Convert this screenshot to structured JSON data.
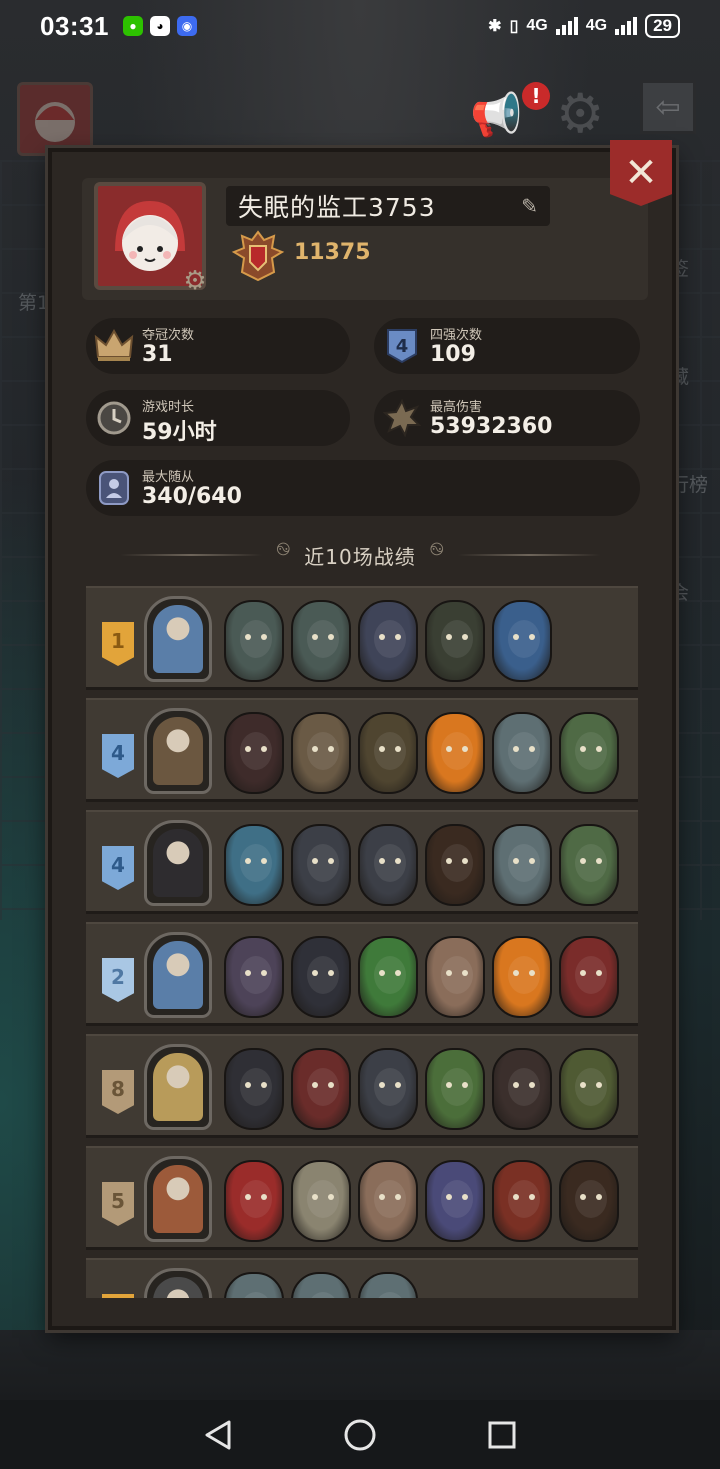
{
  "status_bar": {
    "time": "03:31",
    "network_1": "4G",
    "network_2": "4G",
    "battery": "29"
  },
  "background": {
    "side_labels": [
      "第1",
      "签",
      "藏",
      "行榜",
      "会"
    ]
  },
  "profile": {
    "name": "失眠的监工3753",
    "rating": "11375"
  },
  "stats": {
    "championships": {
      "label": "夺冠次数",
      "value": "31"
    },
    "top4": {
      "label": "四强次数",
      "value": "109"
    },
    "playtime": {
      "label": "游戏时长",
      "value": "59小时"
    },
    "max_damage": {
      "label": "最高伤害",
      "value": "53932360"
    },
    "max_minions": {
      "label": "最大随从",
      "value": "340/640"
    }
  },
  "recent": {
    "title": "近10场战绩"
  },
  "matches": [
    {
      "place": "1",
      "style": "gold",
      "hero_color": "#5a7ea8",
      "minions": [
        "#4a5a55",
        "#4a5a55",
        "#3f4458",
        "#3a3f33",
        "#3a5f8c"
      ]
    },
    {
      "place": "4",
      "style": "blue",
      "hero_color": "#6b5740",
      "minions": [
        "#3e2b2a",
        "#6a5a45",
        "#4f4530",
        "#d9771f",
        "#5e6f73",
        "#4f6a45"
      ]
    },
    {
      "place": "4",
      "style": "blue",
      "hero_color": "#2e2c2f",
      "minions": [
        "#3f6f86",
        "#3c3f47",
        "#3c3f47",
        "#3a2a20",
        "#5e6f73",
        "#4f6a45"
      ]
    },
    {
      "place": "2",
      "style": "lightblue",
      "hero_color": "#5a7ea8",
      "minions": [
        "#4d4358",
        "#2f3038",
        "#3f7a3a",
        "#8a6d5a",
        "#d9771f",
        "#7a2c2a"
      ]
    },
    {
      "place": "8",
      "style": "tan",
      "hero_color": "#b89b5a",
      "minions": [
        "#2f2f35",
        "#6a2c2a",
        "#3c3f47",
        "#4b6e3a",
        "#3b2f2c",
        "#4f5a33"
      ]
    },
    {
      "place": "5",
      "style": "tan",
      "hero_color": "#9c5a3a",
      "minions": [
        "#9a2c2a",
        "#8a8470",
        "#8a6d5a",
        "#4a4a78",
        "#7a3024",
        "#3a2a20"
      ]
    },
    {
      "place": "",
      "style": "gold",
      "hero_color": "#4a4a4a",
      "minions": [
        "#5e6f73",
        "#5e6f73",
        "#5e6f73"
      ]
    }
  ]
}
